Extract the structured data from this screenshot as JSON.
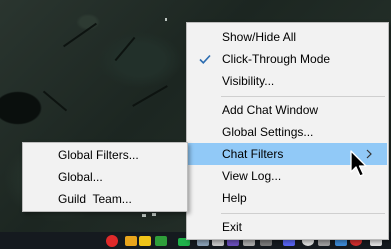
{
  "context_menu": {
    "items": [
      {
        "label": "Show/Hide All"
      },
      {
        "label": "Click-Through Mode",
        "checked": true
      },
      {
        "label": "Visibility..."
      },
      {
        "label": "Add Chat Window"
      },
      {
        "label": "Global Settings..."
      },
      {
        "label": "Chat Filters",
        "highlighted": true,
        "has_submenu": true
      },
      {
        "label": "View Log..."
      },
      {
        "label": "Help"
      },
      {
        "label": "Exit"
      }
    ]
  },
  "submenu": {
    "items": [
      {
        "label": "Global Filters..."
      },
      {
        "label": "Global..."
      },
      {
        "label": "Guild  Team..."
      }
    ]
  },
  "colors": {
    "menu_bg": "#f2f2f2",
    "highlight": "#91c9f7",
    "checkmark": "#2b6cb0",
    "taskbar": "#151a1f"
  },
  "icons": {
    "check": "checkmark-icon",
    "submenu": "chevron-right-icon",
    "cursor": "mouse-pointer-icon"
  }
}
